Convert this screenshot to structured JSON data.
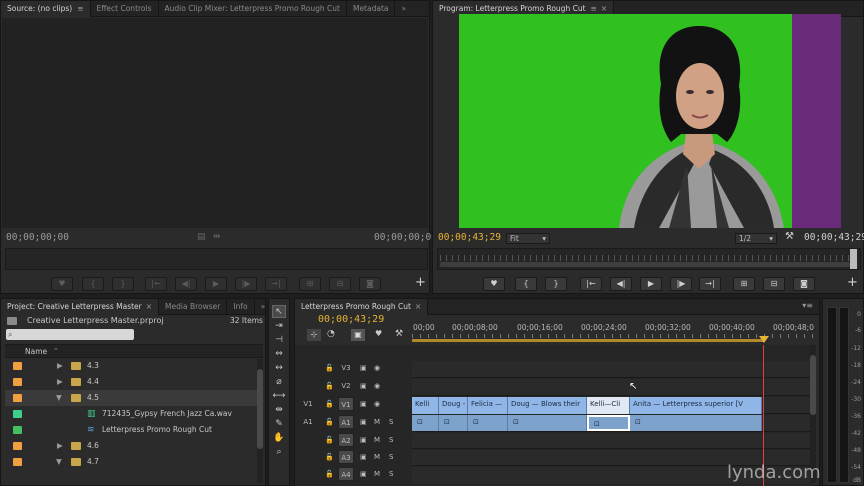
{
  "source_monitor": {
    "tabs": [
      {
        "label": "Source: (no clips)",
        "active": true
      },
      {
        "label": "Effect Controls",
        "active": false
      },
      {
        "label": "Audio Clip Mixer: Letterpress Promo Rough Cut",
        "active": false
      },
      {
        "label": "Metadata",
        "active": false
      }
    ],
    "overflow": "»",
    "timecode_left": "00;00;00;00",
    "timecode_right": "00;00;00;00",
    "add": "+"
  },
  "program_monitor": {
    "tab": "Program: Letterpress Promo Rough Cut",
    "timecode_left": "00;00;43;29",
    "timecode_right": "00;00;43;29",
    "zoom_select": "Fit",
    "resolution_select": "1/2",
    "add": "+"
  },
  "project_panel": {
    "tabs": [
      {
        "label": "Project: Creative Letterpress Master",
        "active": true
      },
      {
        "label": "Media Browser",
        "active": false
      },
      {
        "label": "Info",
        "active": false
      }
    ],
    "overflow": "»",
    "project_file": "Creative Letterpress Master.prproj",
    "item_count": "32 Items",
    "search_placeholder": "",
    "column_name": "Name",
    "items": [
      {
        "label": "4.3",
        "type": "folder",
        "color": "#f0a040",
        "expanded": false,
        "indent": 0
      },
      {
        "label": "4.4",
        "type": "folder",
        "color": "#f0a040",
        "expanded": false,
        "indent": 0
      },
      {
        "label": "4.5",
        "type": "folder",
        "color": "#f0a040",
        "expanded": true,
        "indent": 0
      },
      {
        "label": "712435_Gypsy French Jazz Ca.wav",
        "type": "audio",
        "color": "#3fcf8c",
        "indent": 1
      },
      {
        "label": "Letterpress Promo Rough Cut",
        "type": "sequence",
        "color": "#42c060",
        "indent": 1
      },
      {
        "label": "4.6",
        "type": "folder",
        "color": "#f0a040",
        "expanded": false,
        "indent": 0
      },
      {
        "label": "4.7",
        "type": "folder",
        "color": "#f0a040",
        "expanded": true,
        "indent": 0
      }
    ]
  },
  "timeline": {
    "tab": "Letterpress Promo Rough Cut",
    "timecode": "00;00;43;29",
    "ruler": [
      "00;00",
      "00;00;08;00",
      "00;00;16;00",
      "00;00;24;00",
      "00;00;32;00",
      "00;00;40;00",
      "00;00;48;0"
    ],
    "video_tracks": [
      {
        "name": "V3"
      },
      {
        "name": "V2"
      },
      {
        "name": "V1",
        "source": "V1"
      }
    ],
    "audio_tracks": [
      {
        "name": "A1",
        "source": "A1"
      },
      {
        "name": "A2"
      },
      {
        "name": "A3"
      },
      {
        "name": "A4"
      }
    ],
    "video_clips": [
      "Kelli",
      "Doug -",
      "Felicia —",
      "Doug — Blows their",
      "Kelli—Cli",
      "Anita — Letterpress superior [V"
    ],
    "mute_label": "M",
    "solo_label": "S",
    "playhead_position_seconds": 43.97
  },
  "meter": {
    "scale": [
      "0",
      "-6",
      "-12",
      "-18",
      "-24",
      "-30",
      "-36",
      "-42",
      "-48",
      "-54"
    ],
    "db": "dB"
  },
  "watermark": "lynda.com",
  "colors": {
    "accent_timecode": "#e8b235",
    "greenscreen": "#30c020",
    "clip_video": "#8fb6e6",
    "clip_audio": "#7da3cd",
    "playhead": "#e04040"
  }
}
